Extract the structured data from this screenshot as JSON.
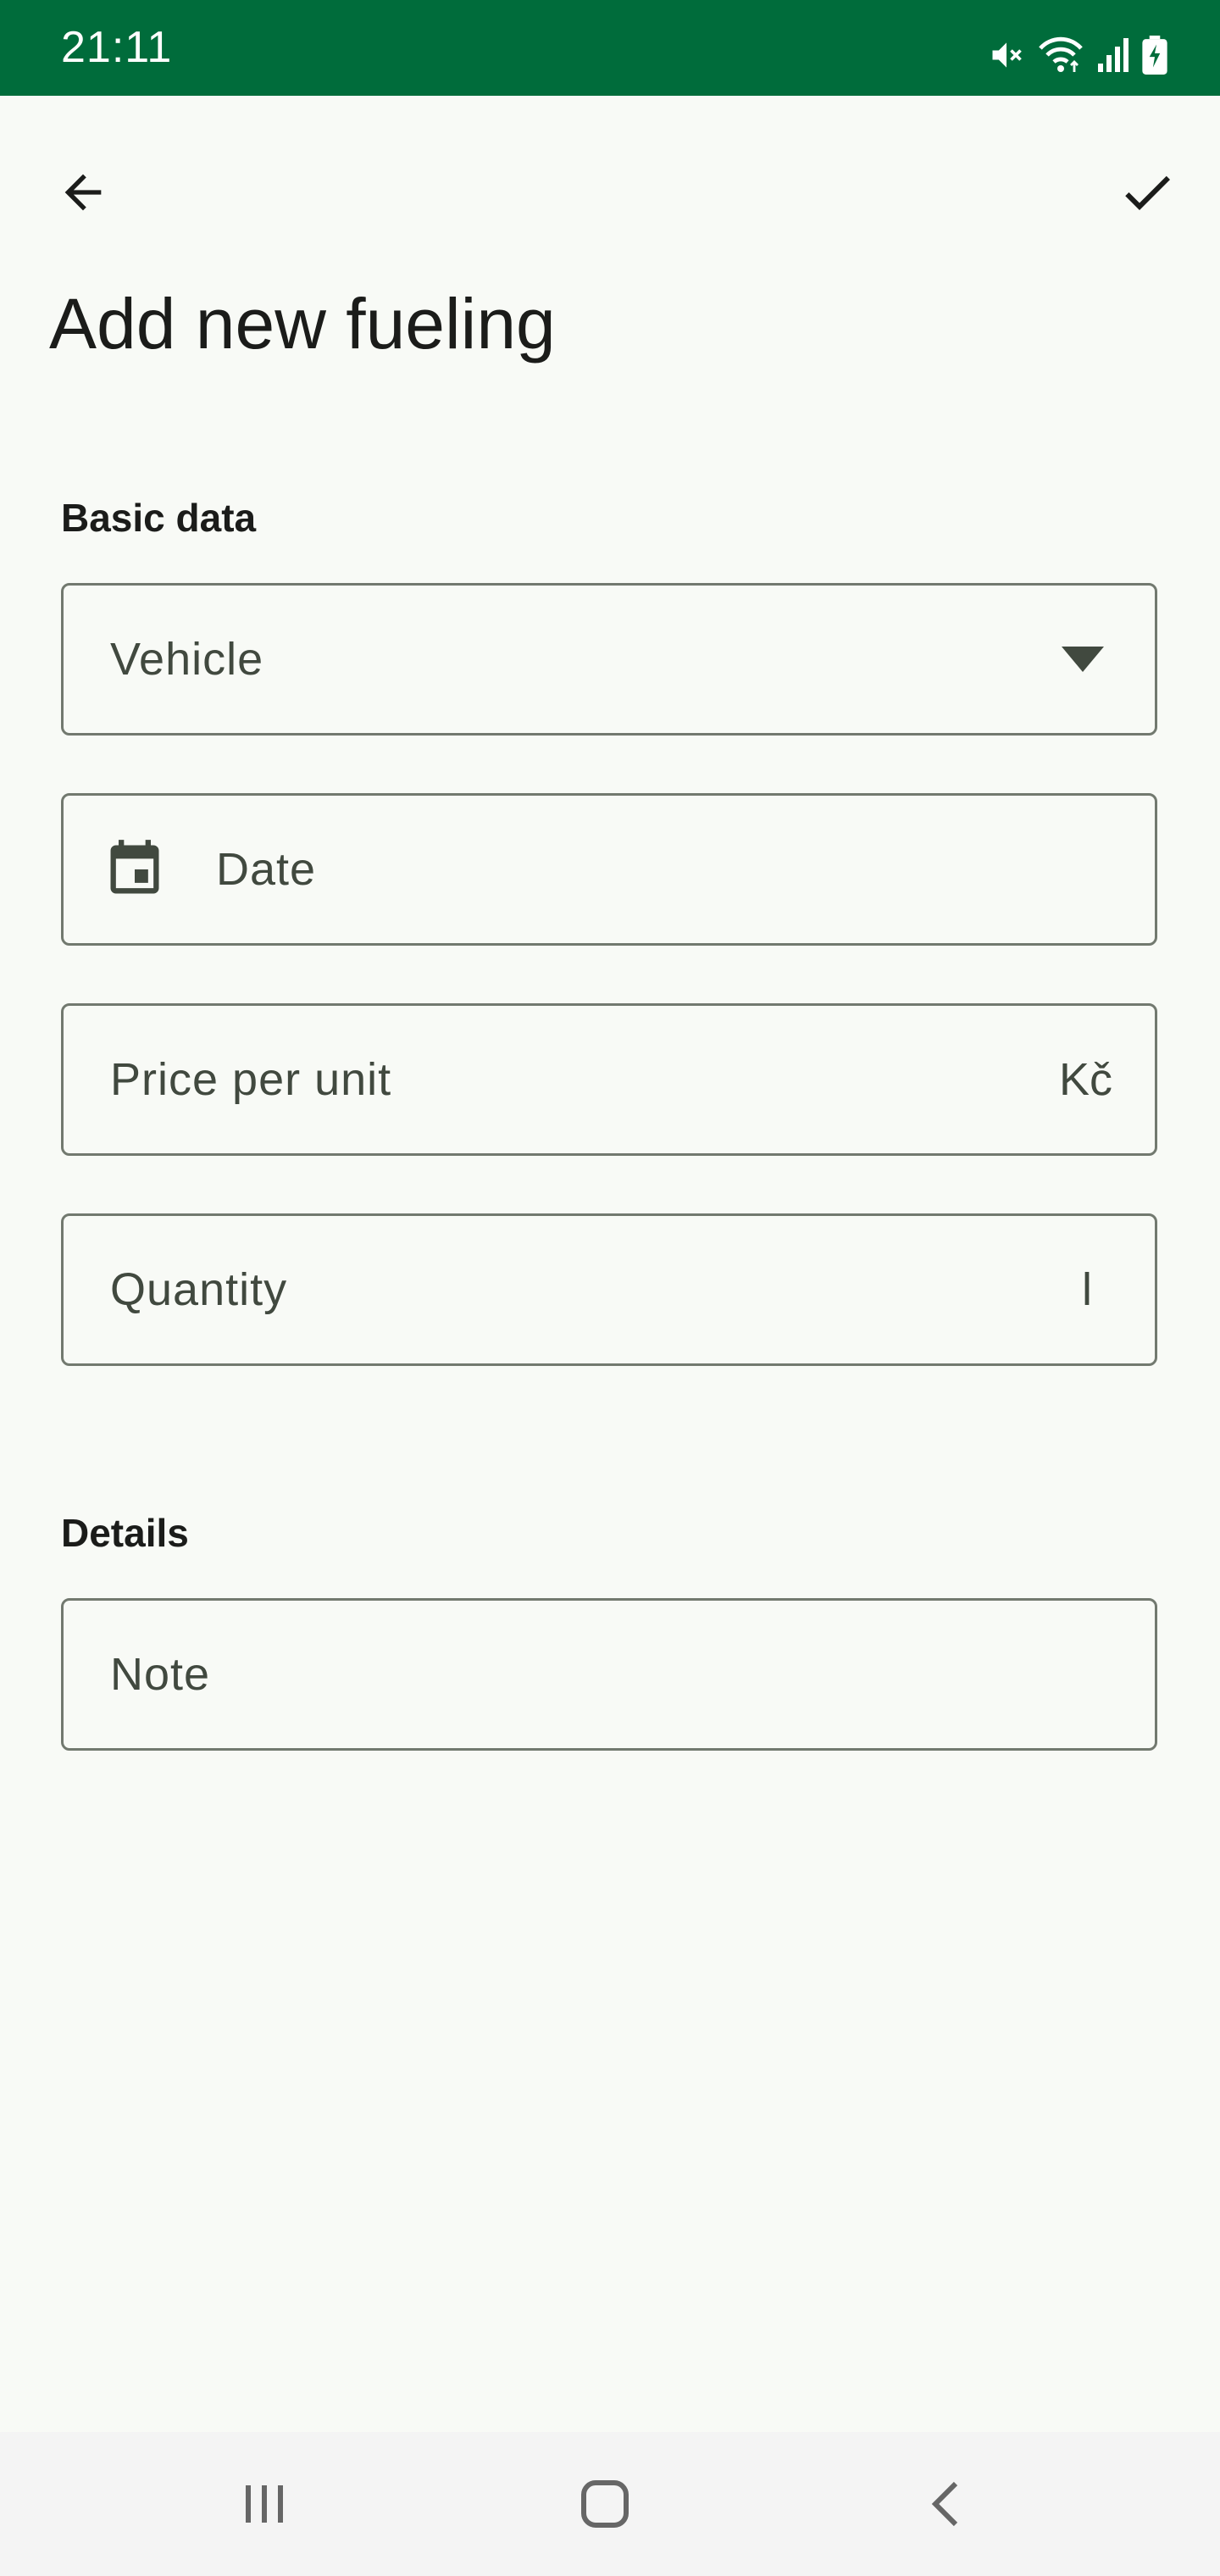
{
  "status_bar": {
    "time": "21:11",
    "icons": [
      "mute-icon",
      "wifi-icon",
      "signal-icon",
      "battery-charging-icon"
    ],
    "background": "#006c3b"
  },
  "toolbar": {
    "back_icon": "arrow-back-icon",
    "confirm_icon": "check-icon"
  },
  "page": {
    "title": "Add new fueling"
  },
  "sections": {
    "basic": {
      "header": "Basic data",
      "vehicle_label": "Vehicle",
      "date_label": "Date",
      "price_label": "Price per unit",
      "price_suffix": "Kč",
      "quantity_label": "Quantity",
      "quantity_suffix": "l"
    },
    "details": {
      "header": "Details",
      "note_label": "Note"
    }
  },
  "navigation_bar": {
    "icons": [
      "recents-icon",
      "home-icon",
      "back-nav-icon"
    ]
  },
  "colors": {
    "accent": "#006c3b",
    "background": "#f8faf6",
    "outline": "#72796f"
  }
}
